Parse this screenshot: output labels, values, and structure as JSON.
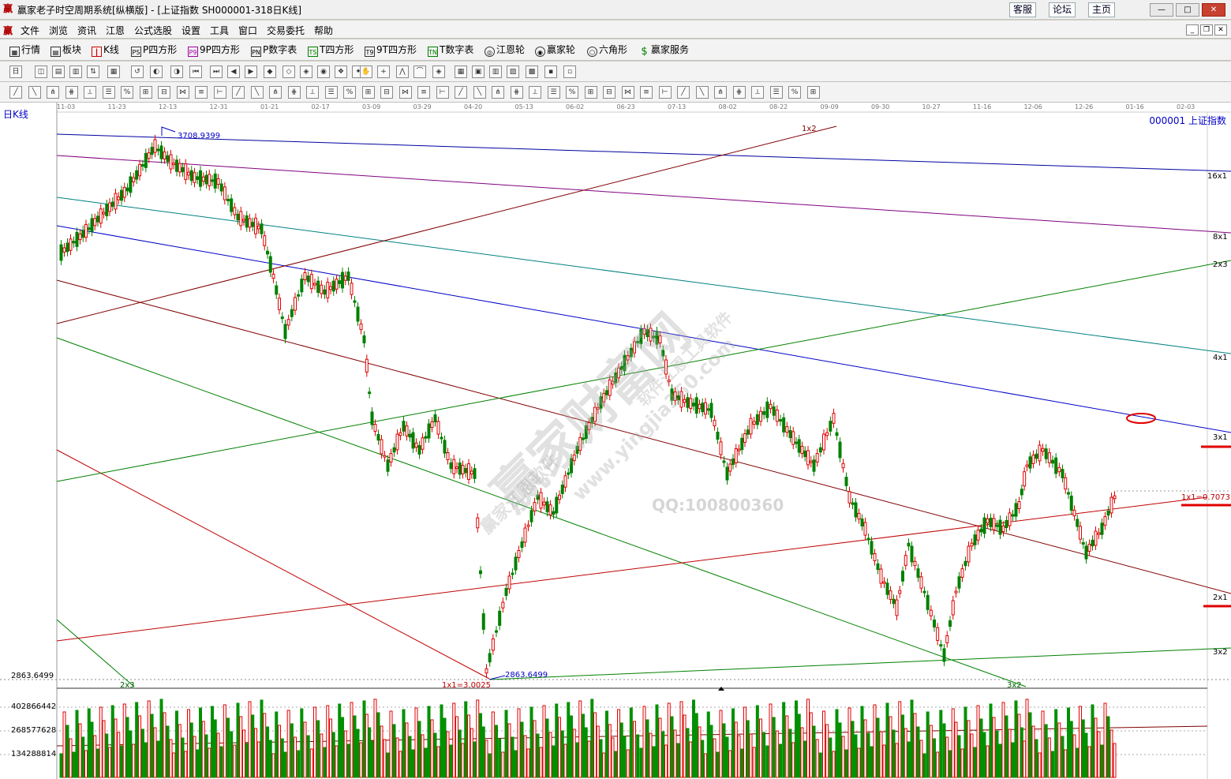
{
  "window": {
    "title": "赢家老子时空周期系统[纵横版] - [上证指数  SH000001-318日K线]",
    "links": [
      "客服",
      "论坛",
      "主页"
    ]
  },
  "menu": [
    "文件",
    "浏览",
    "资讯",
    "江恩",
    "公式选股",
    "设置",
    "工具",
    "窗口",
    "交易委托",
    "帮助"
  ],
  "toolbar1": [
    "行情",
    "板块",
    "K线",
    "P四方形",
    "9P四方形",
    "P数字表",
    "T四方形",
    "9T四方形",
    "T数字表",
    "江恩轮",
    "赢家轮",
    "六角形",
    "赢家服务"
  ],
  "chart": {
    "period_label": "日K线",
    "symbol_label": "000001  上证指数",
    "dates": [
      "11-03",
      "11-23",
      "12-13",
      "12-31",
      "01-21",
      "02-17",
      "03-09",
      "03-29",
      "04-20",
      "05-13",
      "06-02",
      "06-23",
      "07-13",
      "08-02",
      "08-22",
      "09-09",
      "09-30",
      "10-27",
      "11-16",
      "12-06",
      "12-26",
      "01-16",
      "02-03"
    ],
    "high_label": "3708.9399",
    "low_label": "2863.6499",
    "axis_low": "2863.6499",
    "vol_labels": [
      "402866442",
      "268577628",
      "134288814"
    ],
    "gann_labels": {
      "top": "1x2",
      "r16": "16x1",
      "r8": "8x1",
      "r2x3": "2x3",
      "r4": "4x1",
      "r3": "3x1",
      "r1x1": "1x1=0.7073",
      "r2": "2x1",
      "r3x2": "3x2",
      "b2x3": "2x3",
      "b1x1": "1x1=3.0025",
      "b3x2": "3x2"
    },
    "watermark": {
      "main": "赢家财富网",
      "line2": "赢家江恩软件",
      "url": "www.yingjia360.com",
      "line3": "软件江恩工具软件",
      "qq": "QQ:100800360"
    }
  }
}
